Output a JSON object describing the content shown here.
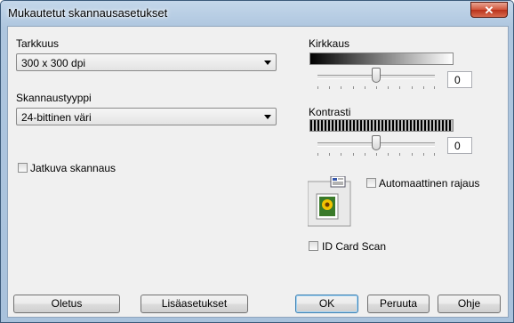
{
  "window": {
    "title": "Mukautetut skannausasetukset",
    "close_glyph": "✕"
  },
  "resolution": {
    "label": "Tarkkuus",
    "value": "300 x 300 dpi"
  },
  "scan_type": {
    "label": "Skannaustyyppi",
    "value": "24-bittinen väri"
  },
  "continuous_scan": {
    "label": "Jatkuva skannaus",
    "checked": false
  },
  "brightness": {
    "label": "Kirkkaus",
    "value": "0",
    "level": 0.5
  },
  "contrast": {
    "label": "Kontrasti",
    "value": "0",
    "level": 0.5
  },
  "auto_crop": {
    "label": "Automaattinen rajaus",
    "checked": false
  },
  "id_card_scan": {
    "label": "ID Card Scan",
    "checked": false
  },
  "buttons": {
    "default": "Oletus",
    "advanced": "Lisäasetukset",
    "ok": "OK",
    "cancel": "Peruuta",
    "help": "Ohje"
  }
}
